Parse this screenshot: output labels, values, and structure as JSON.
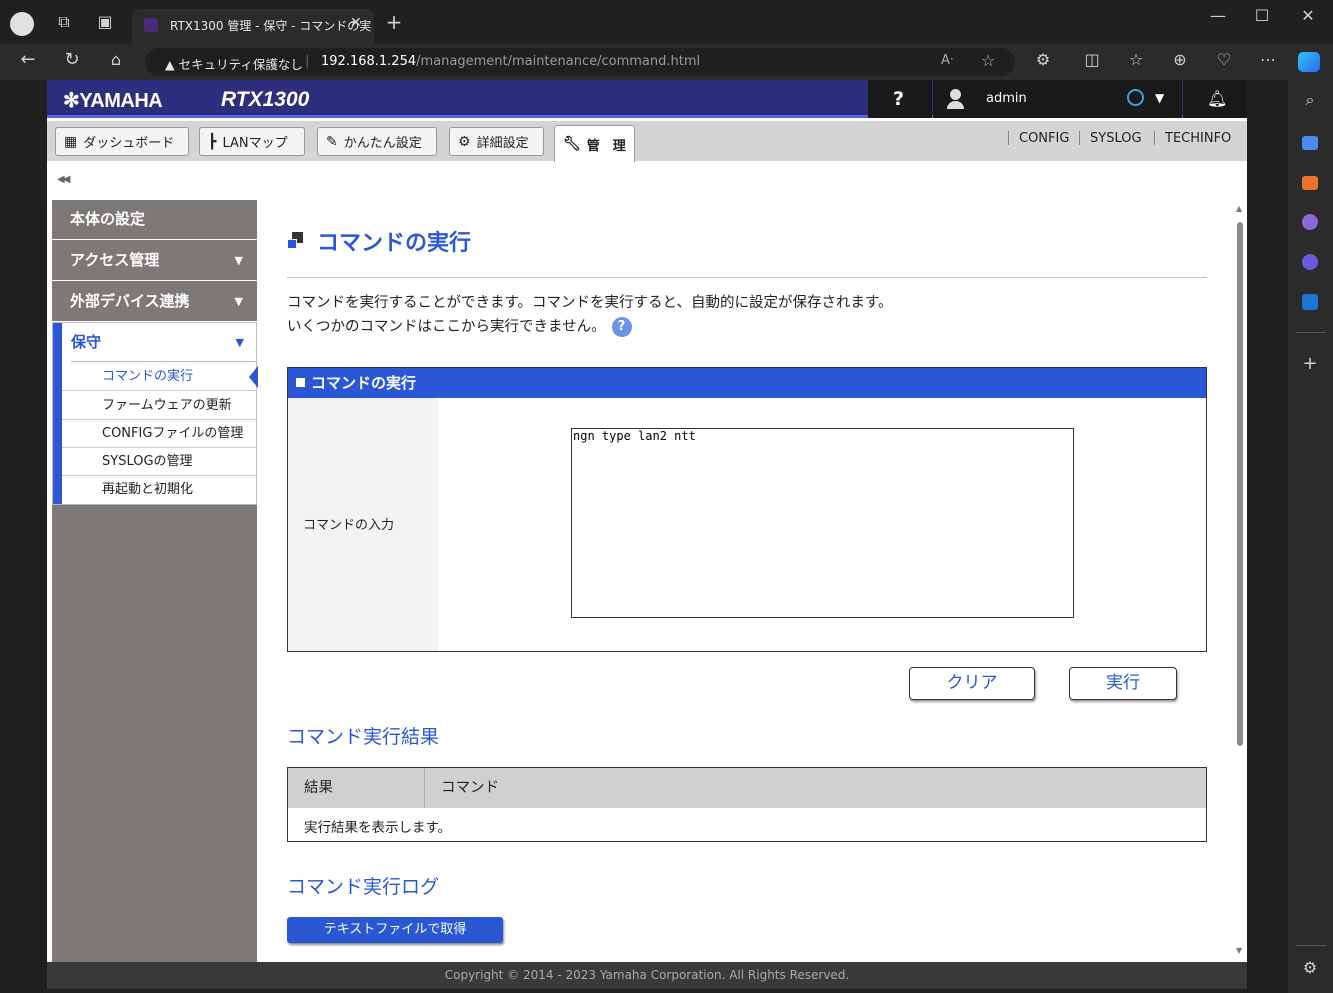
{
  "browser": {
    "tab_title": "RTX1300 管理 - 保守 - コマンドの実",
    "security_label": "セキュリティ保護なし",
    "url_host": "192.168.1.254",
    "url_path": "/management/maintenance/command.html"
  },
  "header": {
    "brand": "YAMAHA",
    "model": "RTX1300",
    "help": "?",
    "user": "admin"
  },
  "nav": {
    "tabs": [
      {
        "label": "ダッシュボード",
        "icon": "dashboard-icon"
      },
      {
        "label": "LANマップ",
        "icon": "lanmap-icon"
      },
      {
        "label": "かんたん設定",
        "icon": "wand-icon"
      },
      {
        "label": "詳細設定",
        "icon": "gear-icon"
      },
      {
        "label": "管　理",
        "icon": "wrench-icon"
      }
    ],
    "links": [
      "CONFIG",
      "SYSLOG",
      "TECHINFO"
    ]
  },
  "sidebar": {
    "sections": [
      "本体の設定",
      "アクセス管理",
      "外部デバイス連携"
    ],
    "active_section": "保守",
    "sub_items": [
      "コマンドの実行",
      "ファームウェアの更新",
      "CONFIGファイルの管理",
      "SYSLOGの管理",
      "再起動と初期化"
    ]
  },
  "main": {
    "title": "コマンドの実行",
    "desc1": "コマンドを実行することができます。コマンドを実行すると、自動的に設定が保存されます。",
    "desc2": "いくつかのコマンドはここから実行できません。",
    "box_title": "コマンドの実行",
    "input_label": "コマンドの入力",
    "command_value": "ngn type lan2 ntt",
    "clear_label": "クリア",
    "execute_label": "実行",
    "results_title": "コマンド実行結果",
    "results_headers": [
      "結果",
      "コマンド"
    ],
    "results_placeholder": "実行結果を表示します。",
    "log_title": "コマンド実行ログ",
    "log_button": "テキストファイルで取得"
  },
  "footer": {
    "copyright": "Copyright © 2014 - 2023 Yamaha Corporation. All Rights Reserved."
  }
}
